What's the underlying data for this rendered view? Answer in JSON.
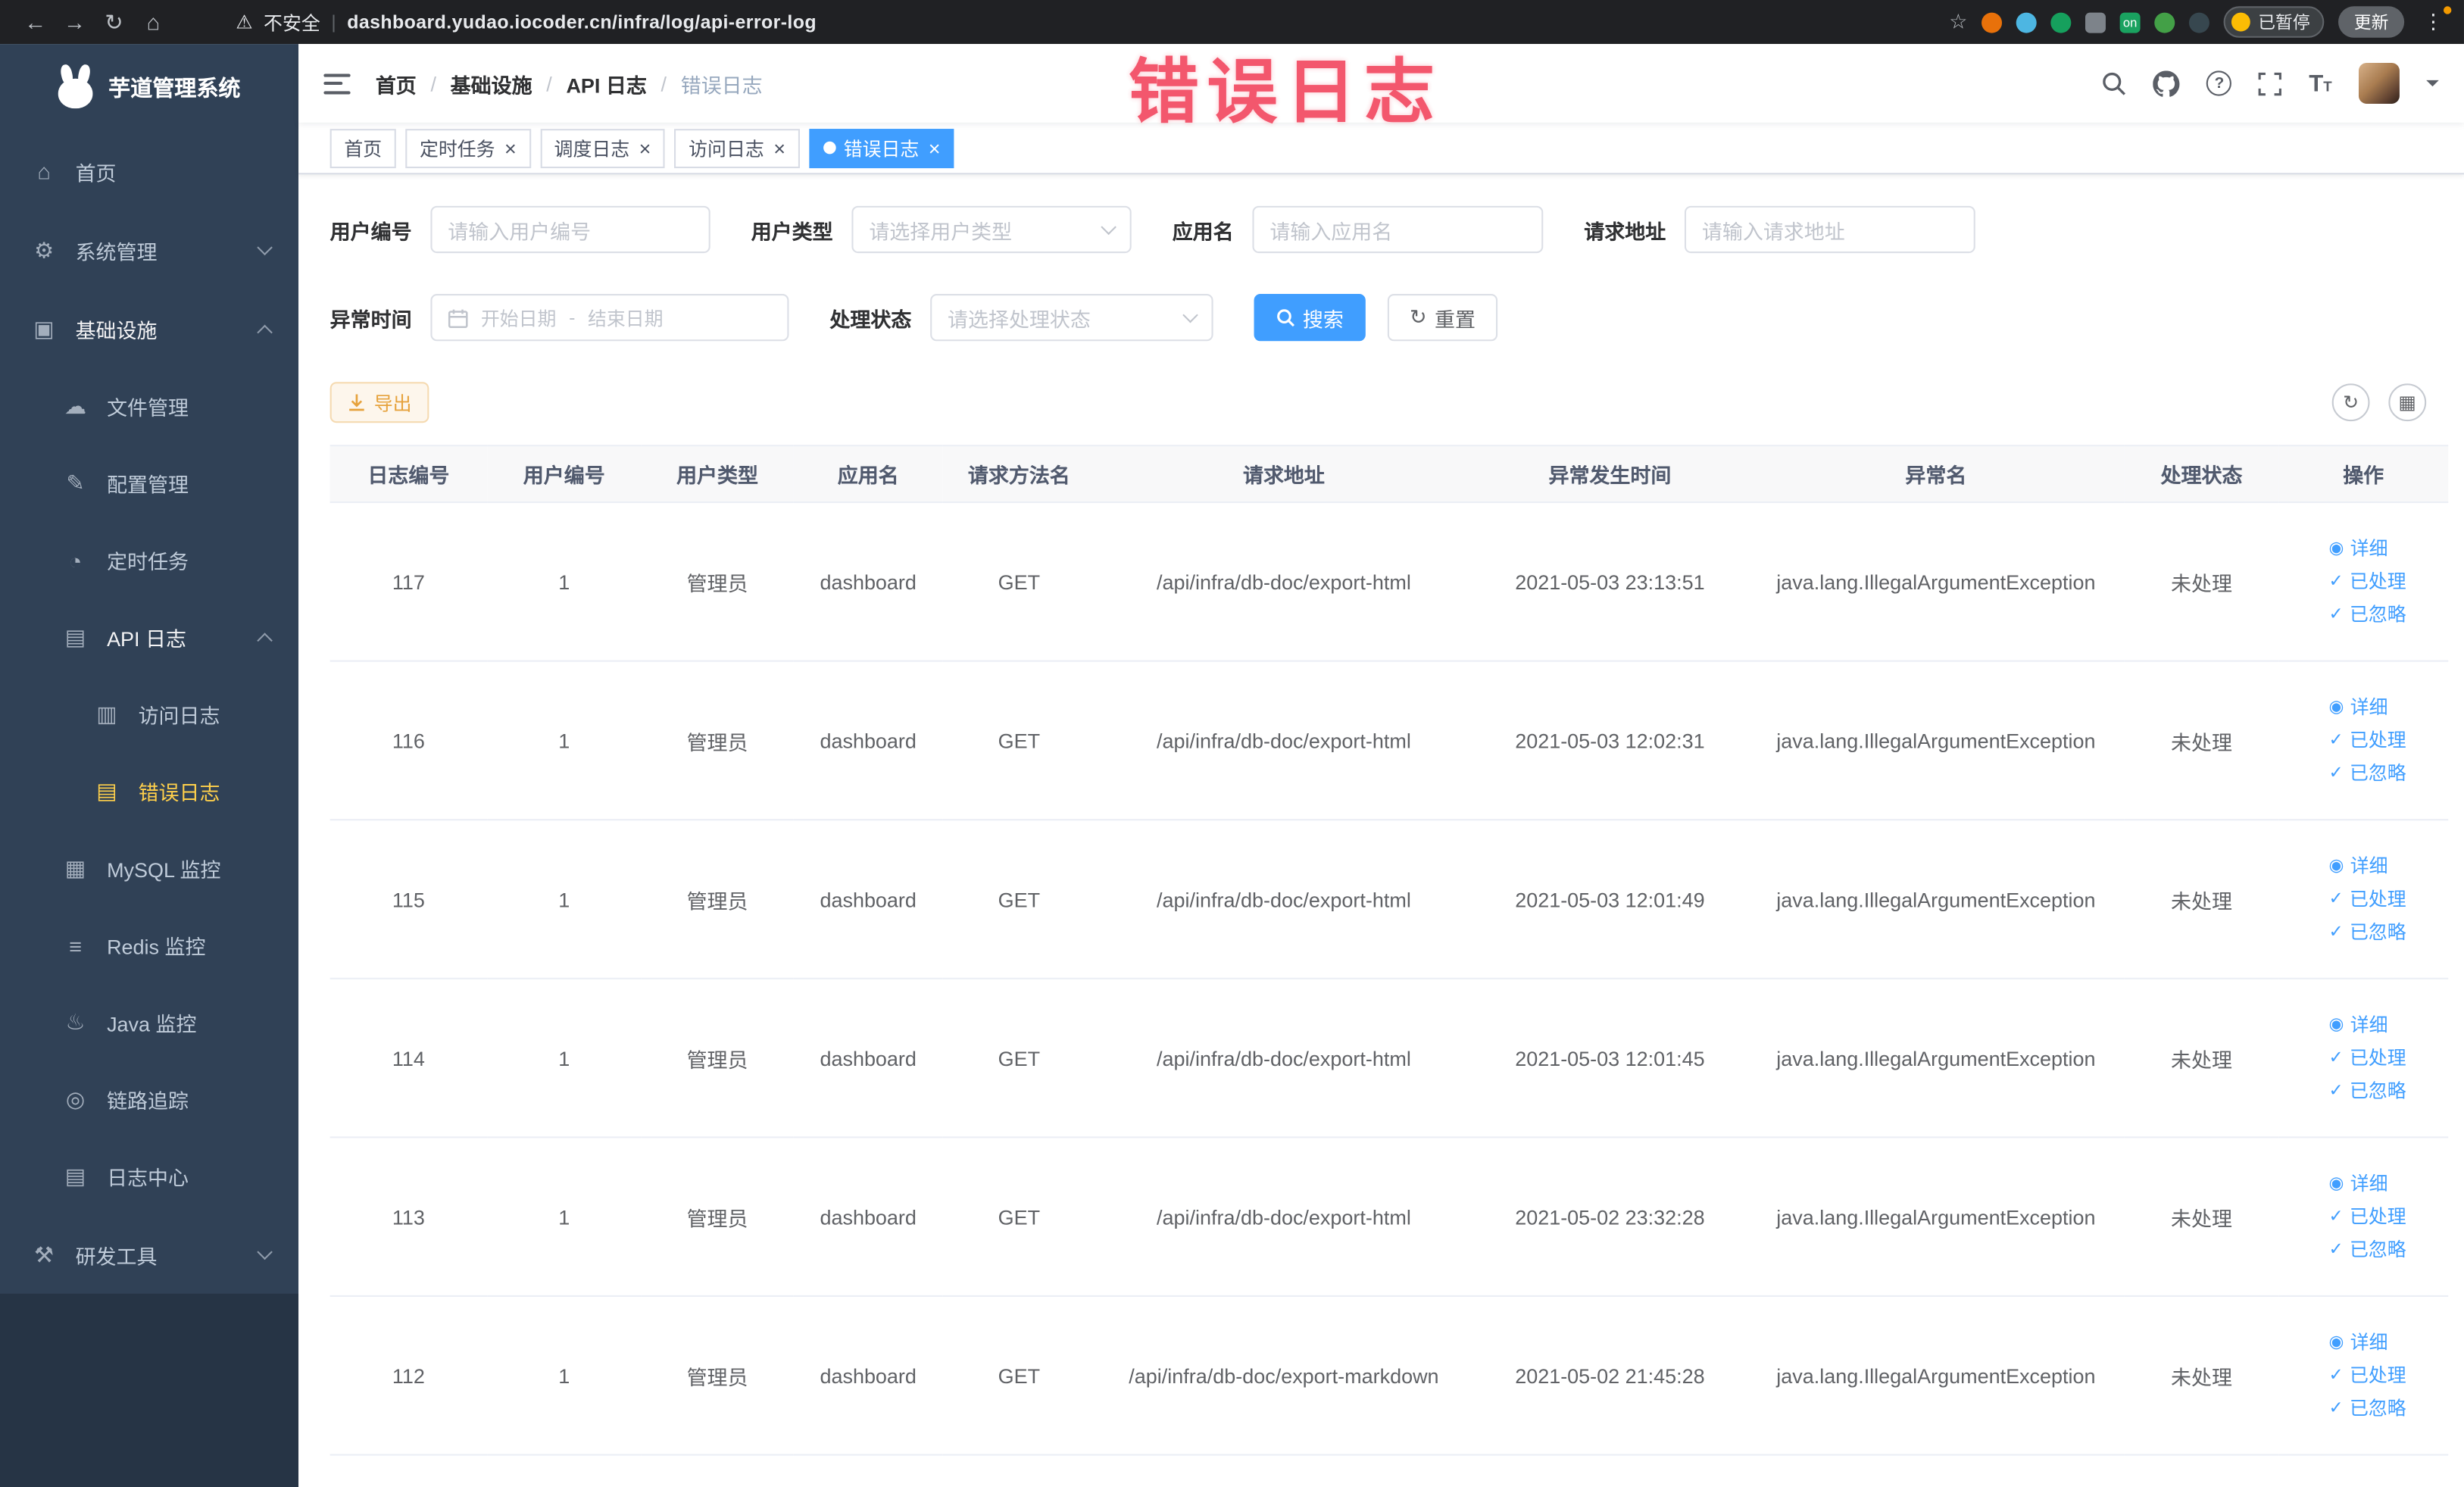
{
  "browser": {
    "security_label": "不安全",
    "url_separator": "|",
    "url": "dashboard.yudao.iocoder.cn/infra/log/api-error-log",
    "paused_badge": "已暂停",
    "update_button": "更新",
    "extension_on_badge": "on"
  },
  "watermark": "错误日志",
  "sidebar": {
    "logo_title": "芋道管理系统",
    "items": [
      {
        "label": "首页",
        "icon": "⌂"
      },
      {
        "label": "系统管理",
        "icon": "⚙"
      },
      {
        "label": "基础设施",
        "icon": "▣"
      },
      {
        "label": "文件管理",
        "icon": "☁"
      },
      {
        "label": "配置管理",
        "icon": "✎"
      },
      {
        "label": "定时任务",
        "icon": "◔"
      },
      {
        "label": "API 日志",
        "icon": "▤"
      },
      {
        "label": "访问日志",
        "icon": "▥"
      },
      {
        "label": "错误日志",
        "icon": "▤"
      },
      {
        "label": "MySQL 监控",
        "icon": "▦"
      },
      {
        "label": "Redis 监控",
        "icon": "≡"
      },
      {
        "label": "Java 监控",
        "icon": "♨"
      },
      {
        "label": "链路追踪",
        "icon": "◎"
      },
      {
        "label": "日志中心",
        "icon": "▤"
      },
      {
        "label": "研发工具",
        "icon": "⚒"
      }
    ]
  },
  "breadcrumb": [
    "首页",
    "基础设施",
    "API 日志",
    "错误日志"
  ],
  "tabs": [
    {
      "label": "首页"
    },
    {
      "label": "定时任务"
    },
    {
      "label": "调度日志"
    },
    {
      "label": "访问日志"
    },
    {
      "label": "错误日志"
    }
  ],
  "filters": {
    "user_id": {
      "label": "用户编号",
      "placeholder": "请输入用户编号"
    },
    "user_type": {
      "label": "用户类型",
      "placeholder": "请选择用户类型"
    },
    "app_name": {
      "label": "应用名",
      "placeholder": "请输入应用名"
    },
    "request_url": {
      "label": "请求地址",
      "placeholder": "请输入请求地址"
    },
    "exception_time": {
      "label": "异常时间",
      "start_placeholder": "开始日期",
      "separator": "-",
      "end_placeholder": "结束日期"
    },
    "process_status": {
      "label": "处理状态",
      "placeholder": "请选择处理状态"
    },
    "search_button": "搜索",
    "reset_button": "重置"
  },
  "toolbar": {
    "export_button": "导出"
  },
  "table": {
    "columns": [
      "日志编号",
      "用户编号",
      "用户类型",
      "应用名",
      "请求方法名",
      "请求地址",
      "异常发生时间",
      "异常名",
      "处理状态",
      "操作"
    ],
    "actions": [
      "详细",
      "已处理",
      "已忽略"
    ],
    "rows": [
      {
        "id": "117",
        "user_id": "1",
        "user_type": "管理员",
        "app": "dashboard",
        "method": "GET",
        "url": "/api/infra/db-doc/export-html",
        "time": "2021-05-03 23:13:51",
        "exception": "java.lang.IllegalArgumentException",
        "status": "未处理"
      },
      {
        "id": "116",
        "user_id": "1",
        "user_type": "管理员",
        "app": "dashboard",
        "method": "GET",
        "url": "/api/infra/db-doc/export-html",
        "time": "2021-05-03 12:02:31",
        "exception": "java.lang.IllegalArgumentException",
        "status": "未处理"
      },
      {
        "id": "115",
        "user_id": "1",
        "user_type": "管理员",
        "app": "dashboard",
        "method": "GET",
        "url": "/api/infra/db-doc/export-html",
        "time": "2021-05-03 12:01:49",
        "exception": "java.lang.IllegalArgumentException",
        "status": "未处理"
      },
      {
        "id": "114",
        "user_id": "1",
        "user_type": "管理员",
        "app": "dashboard",
        "method": "GET",
        "url": "/api/infra/db-doc/export-html",
        "time": "2021-05-03 12:01:45",
        "exception": "java.lang.IllegalArgumentException",
        "status": "未处理"
      },
      {
        "id": "113",
        "user_id": "1",
        "user_type": "管理员",
        "app": "dashboard",
        "method": "GET",
        "url": "/api/infra/db-doc/export-html",
        "time": "2021-05-02 23:32:28",
        "exception": "java.lang.IllegalArgumentException",
        "status": "未处理"
      },
      {
        "id": "112",
        "user_id": "1",
        "user_type": "管理员",
        "app": "dashboard",
        "method": "GET",
        "url": "/api/infra/db-doc/export-markdown",
        "time": "2021-05-02 21:45:28",
        "exception": "java.lang.IllegalArgumentException",
        "status": "未处理"
      }
    ]
  },
  "icons": {
    "back": "←",
    "forward": "→",
    "reload": "↻",
    "home": "⌂",
    "warning": "⚠",
    "star": "☆",
    "more": "⋮",
    "close": "×",
    "refresh": "↻",
    "grid": "▦",
    "eye": "◉",
    "check": "✓",
    "question": "?"
  }
}
